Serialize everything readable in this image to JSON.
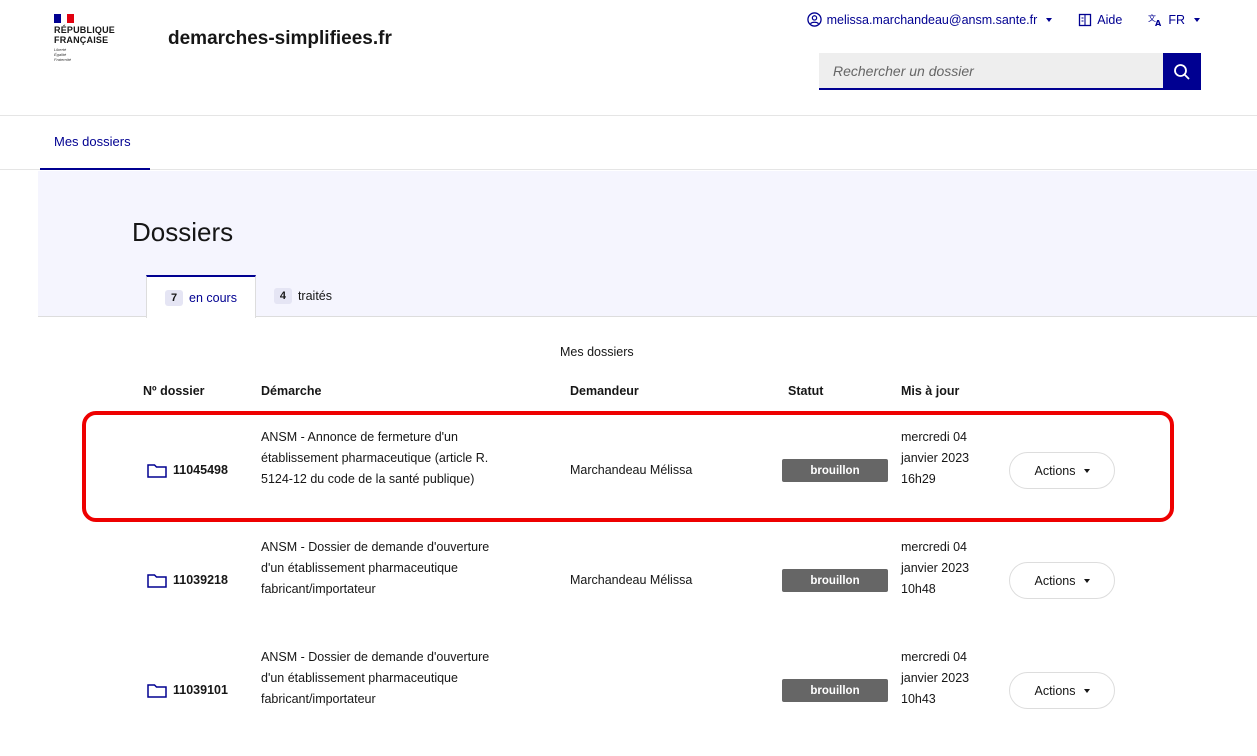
{
  "header": {
    "logo_lines": [
      "RÉPUBLIQUE",
      "FRANÇAISE"
    ],
    "motto_lines": [
      "Liberté",
      "Égalité",
      "Fraternité"
    ],
    "service_title": "demarches-simplifiees.fr",
    "user_email": "melissa.marchandeau@ansm.sante.fr",
    "help_label": "Aide",
    "lang_label": "FR",
    "search_placeholder": "Rechercher un dossier"
  },
  "subnav": {
    "item": "Mes dossiers"
  },
  "page": {
    "title": "Dossiers",
    "tabs": [
      {
        "count": "7",
        "label": "en cours"
      },
      {
        "count": "4",
        "label": "traités"
      }
    ]
  },
  "table": {
    "caption": "Mes dossiers",
    "headers": [
      "Nº dossier",
      "Démarche",
      "Demandeur",
      "Statut",
      "Mis à jour"
    ],
    "rows": [
      {
        "number": "11045498",
        "demarche": [
          "ANSM - Annonce de fermeture d'un",
          "établissement pharmaceutique (article R.",
          "5124-12 du code de la santé publique)"
        ],
        "demandeur": "Marchandeau Mélissa",
        "statut": "brouillon",
        "date": [
          "mercredi 04",
          "janvier 2023",
          "16h29"
        ],
        "actions": "Actions"
      },
      {
        "number": "11039218",
        "demarche": [
          "ANSM - Dossier de demande d'ouverture",
          "d'un établissement pharmaceutique",
          "fabricant/importateur"
        ],
        "demandeur": "Marchandeau Mélissa",
        "statut": "brouillon",
        "date": [
          "mercredi 04",
          "janvier 2023",
          "10h48"
        ],
        "actions": "Actions"
      },
      {
        "number": "11039101",
        "demarche": [
          "ANSM - Dossier de demande d'ouverture",
          "d'un établissement pharmaceutique",
          "fabricant/importateur"
        ],
        "demandeur": "",
        "statut": "brouillon",
        "date": [
          "mercredi 04",
          "janvier 2023",
          "10h43"
        ],
        "actions": "Actions"
      }
    ]
  },
  "colors": {
    "primary": "#000091",
    "badge": "#666666",
    "highlight": "#ee0000",
    "band": "#f5f5fe"
  }
}
